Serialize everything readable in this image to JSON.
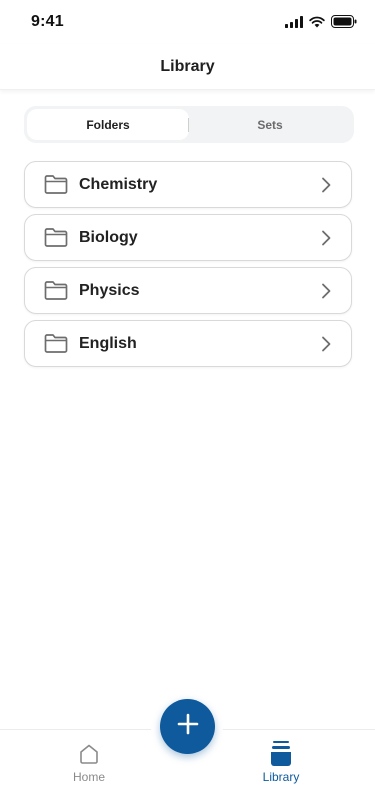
{
  "status_bar": {
    "time": "9:41"
  },
  "header": {
    "title": "Library"
  },
  "segmented": {
    "tabs": [
      {
        "label": "Folders",
        "selected": true
      },
      {
        "label": "Sets",
        "selected": false
      }
    ]
  },
  "folders": [
    {
      "name": "Chemistry"
    },
    {
      "name": "Biology"
    },
    {
      "name": "Physics"
    },
    {
      "name": "English"
    }
  ],
  "fab": {
    "icon": "plus-icon"
  },
  "tab_bar": {
    "items": [
      {
        "label": "Home",
        "icon": "home-icon",
        "active": false
      },
      {
        "label": "Library",
        "icon": "library-icon",
        "active": true
      }
    ]
  },
  "colors": {
    "accent": "#0e5a9c",
    "inactive": "#8a8a8a",
    "border": "#d9d9d9"
  }
}
